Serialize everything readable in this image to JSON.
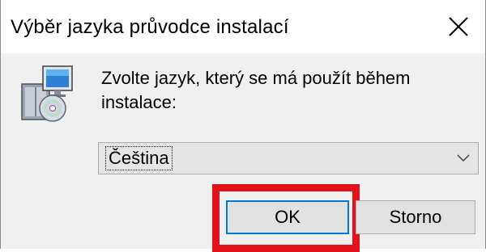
{
  "window": {
    "title": "Výběr jazyka průvodce instalací"
  },
  "icons": {
    "close": "close-icon",
    "setup": "setup-computer-icon",
    "dropdown": "chevron-down-icon"
  },
  "dialog": {
    "prompt": "Zvolte jazyk, který se má použít během instalace:",
    "language_select": {
      "selected": "Čeština"
    },
    "ok_label": "OK",
    "cancel_label": "Storno"
  },
  "colors": {
    "highlight": "#e3111a",
    "focus_border": "#0078d7",
    "dialog_bg": "#f0f0f0"
  }
}
